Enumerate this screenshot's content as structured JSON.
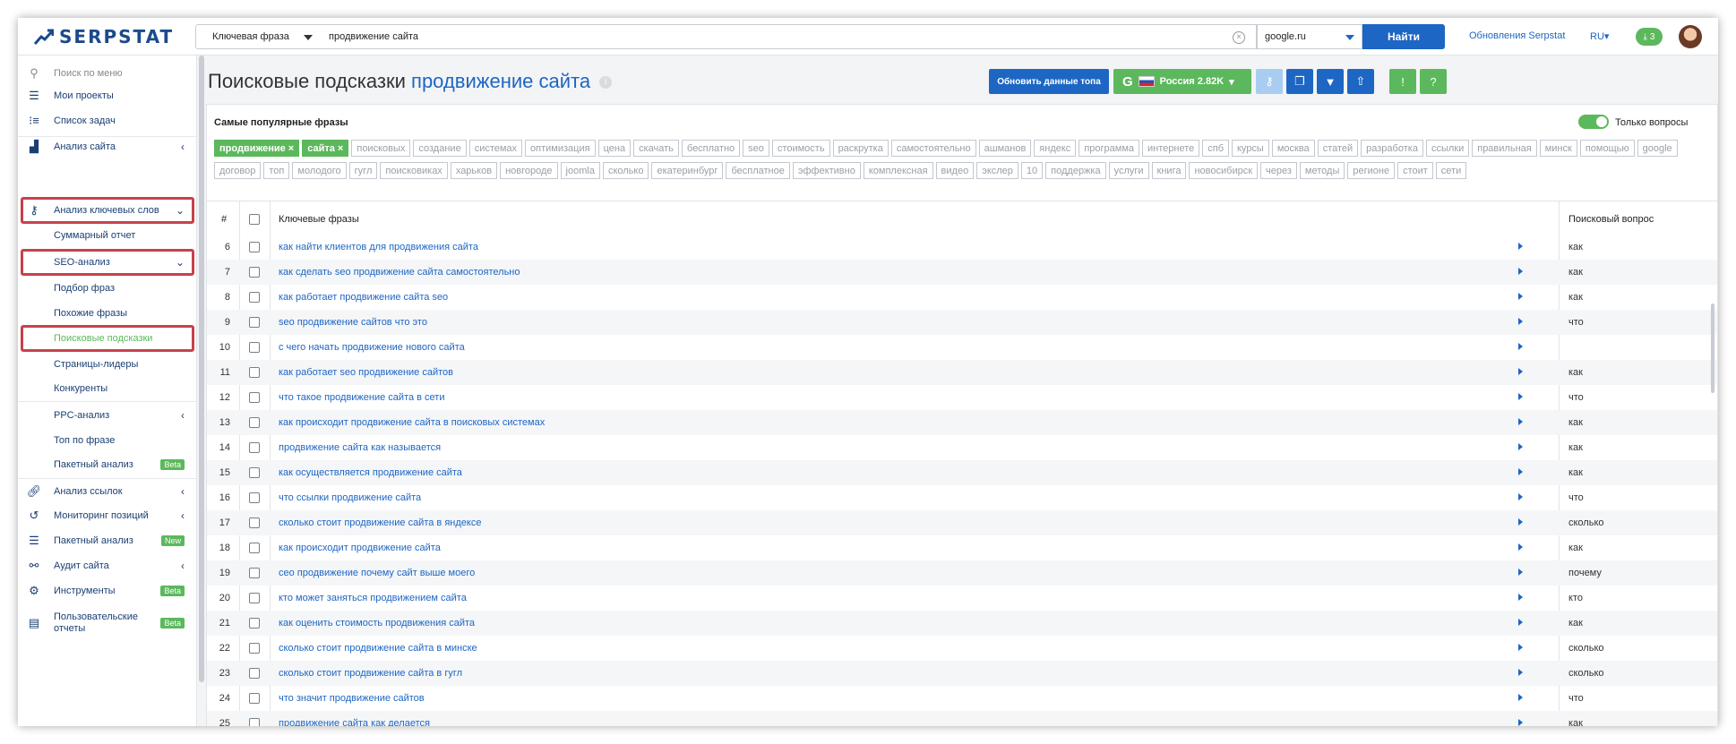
{
  "header": {
    "logo_text": "SERPSTAT",
    "query_type": "Ключевая фраза",
    "query_value": "продвижение сайта",
    "database": "google.ru",
    "find_label": "Найти",
    "updates_link": "Обновления Serpstat",
    "lang": "RU▾",
    "downloads_count": "3"
  },
  "sidebar": {
    "search_placeholder": "Поиск по меню",
    "items": [
      {
        "label": "Мои проекты"
      },
      {
        "label": "Список задач"
      },
      {
        "label": "Анализ сайта"
      },
      {
        "label": "Анализ ключевых слов"
      },
      {
        "label": "Суммарный отчет"
      },
      {
        "label": "SEO-анализ"
      },
      {
        "label": "Подбор фраз"
      },
      {
        "label": "Похожие фразы"
      },
      {
        "label": "Поисковые подсказки"
      },
      {
        "label": "Страницы-лидеры"
      },
      {
        "label": "Конкуренты"
      },
      {
        "label": "PPC-анализ"
      },
      {
        "label": "Топ по фразе"
      },
      {
        "label": "Пакетный анализ",
        "badge": "Beta"
      },
      {
        "label": "Анализ ссылок"
      },
      {
        "label": "Мониторинг позиций"
      },
      {
        "label": "Пакетный анализ",
        "badge": "New"
      },
      {
        "label": "Аудит сайта"
      },
      {
        "label": "Инструменты",
        "badge": "Beta"
      },
      {
        "label": "Пользовательские отчеты",
        "badge": "Beta"
      }
    ]
  },
  "page": {
    "title": "Поисковые подсказки",
    "title_query": "продвижение сайта",
    "update_top_label": "Обновить данные топа",
    "region_label": "Россия 2.82K",
    "panel_title": "Самые популярные фразы",
    "only_questions_label": "Только вопросы"
  },
  "tags": [
    {
      "label": "продвижение ×",
      "selected": true
    },
    {
      "label": "сайта ×",
      "selected": true
    },
    {
      "label": "поисковых"
    },
    {
      "label": "создание"
    },
    {
      "label": "системах"
    },
    {
      "label": "оптимизация"
    },
    {
      "label": "цена"
    },
    {
      "label": "скачать"
    },
    {
      "label": "бесплатно"
    },
    {
      "label": "seo"
    },
    {
      "label": "стоимость"
    },
    {
      "label": "раскрутка"
    },
    {
      "label": "самостоятельно"
    },
    {
      "label": "ашманов"
    },
    {
      "label": "яндекс"
    },
    {
      "label": "программа"
    },
    {
      "label": "интернете"
    },
    {
      "label": "спб"
    },
    {
      "label": "курсы"
    },
    {
      "label": "москва"
    },
    {
      "label": "статей"
    },
    {
      "label": "разработка"
    },
    {
      "label": "ссылки"
    },
    {
      "label": "правильная"
    },
    {
      "label": "минск"
    },
    {
      "label": "помощью"
    },
    {
      "label": "google"
    },
    {
      "label": "договор"
    },
    {
      "label": "топ"
    },
    {
      "label": "молодого"
    },
    {
      "label": "гугл"
    },
    {
      "label": "поисковиках"
    },
    {
      "label": "харьков"
    },
    {
      "label": "новгороде"
    },
    {
      "label": "joomla"
    },
    {
      "label": "сколько"
    },
    {
      "label": "екатеринбург"
    },
    {
      "label": "бесплатное"
    },
    {
      "label": "эффективно"
    },
    {
      "label": "комплексная"
    },
    {
      "label": "видео"
    },
    {
      "label": "экслер"
    },
    {
      "label": "10"
    },
    {
      "label": "поддержка"
    },
    {
      "label": "услуги"
    },
    {
      "label": "книга"
    },
    {
      "label": "новосибирск"
    },
    {
      "label": "через"
    },
    {
      "label": "методы"
    },
    {
      "label": "регионе"
    },
    {
      "label": "стоит"
    },
    {
      "label": "сети"
    }
  ],
  "table": {
    "col_num": "#",
    "col_keyword": "Ключевые фразы",
    "col_question": "Поисковый вопрос",
    "rows": [
      {
        "n": "6",
        "kw": "как найти клиентов для продвижения сайта",
        "q": "как"
      },
      {
        "n": "7",
        "kw": "как сделать seo продвижение сайта самостоятельно",
        "q": "как"
      },
      {
        "n": "8",
        "kw": "как работает продвижение сайта seo",
        "q": "как"
      },
      {
        "n": "9",
        "kw": "seo продвижение сайтов что это",
        "q": "что"
      },
      {
        "n": "10",
        "kw": "с чего начать продвижение нового сайта",
        "q": ""
      },
      {
        "n": "11",
        "kw": "как работает seo продвижение сайтов",
        "q": "как"
      },
      {
        "n": "12",
        "kw": "что такое продвижение сайта в сети",
        "q": "что"
      },
      {
        "n": "13",
        "kw": "как происходит продвижение сайта в поисковых системах",
        "q": "как"
      },
      {
        "n": "14",
        "kw": "продвижение сайта как называется",
        "q": "как"
      },
      {
        "n": "15",
        "kw": "как осуществляется продвижение сайта",
        "q": "как"
      },
      {
        "n": "16",
        "kw": "что ссылки продвижение сайта",
        "q": "что"
      },
      {
        "n": "17",
        "kw": "сколько стоит продвижение сайта в яндексе",
        "q": "сколько"
      },
      {
        "n": "18",
        "kw": "как происходит продвижение сайта",
        "q": "как"
      },
      {
        "n": "19",
        "kw": "сео продвижение почему сайт выше моего",
        "q": "почему"
      },
      {
        "n": "20",
        "kw": "кто может заняться продвижением сайта",
        "q": "кто"
      },
      {
        "n": "21",
        "kw": "как оценить стоимость продвижения сайта",
        "q": "как"
      },
      {
        "n": "22",
        "kw": "сколько стоит продвижение сайта в минске",
        "q": "сколько"
      },
      {
        "n": "23",
        "kw": "сколько стоит продвижение сайта в гугл",
        "q": "сколько"
      },
      {
        "n": "24",
        "kw": "что значит продвижение сайтов",
        "q": "что"
      },
      {
        "n": "25",
        "kw": "продвижение сайта как делается",
        "q": "как"
      }
    ]
  }
}
